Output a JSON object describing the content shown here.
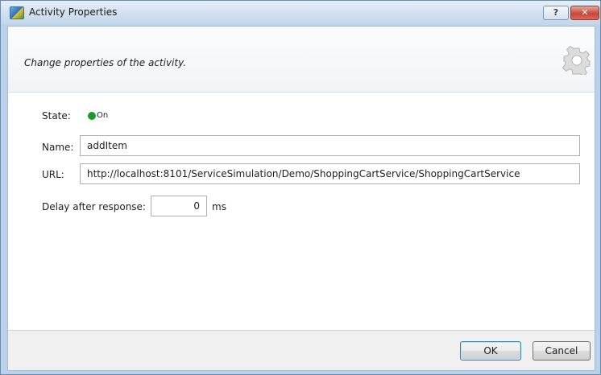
{
  "window": {
    "title": "Activity Properties",
    "help_glyph": "?",
    "close_glyph": "✕"
  },
  "header": {
    "subtitle": "Change properties of the activity.",
    "icon": "gear-icon"
  },
  "form": {
    "state": {
      "label": "State:",
      "value": "On",
      "indicator_color": "#1a9a28"
    },
    "name": {
      "label": "Name:",
      "value": "addItem"
    },
    "url": {
      "label": "URL:",
      "value": "http://localhost:8101/ServiceSimulation/Demo/ShoppingCartService/ShoppingCartService"
    },
    "delay": {
      "label": "Delay after response:",
      "value": "0",
      "unit": "ms"
    }
  },
  "buttons": {
    "ok": "OK",
    "cancel": "Cancel"
  }
}
